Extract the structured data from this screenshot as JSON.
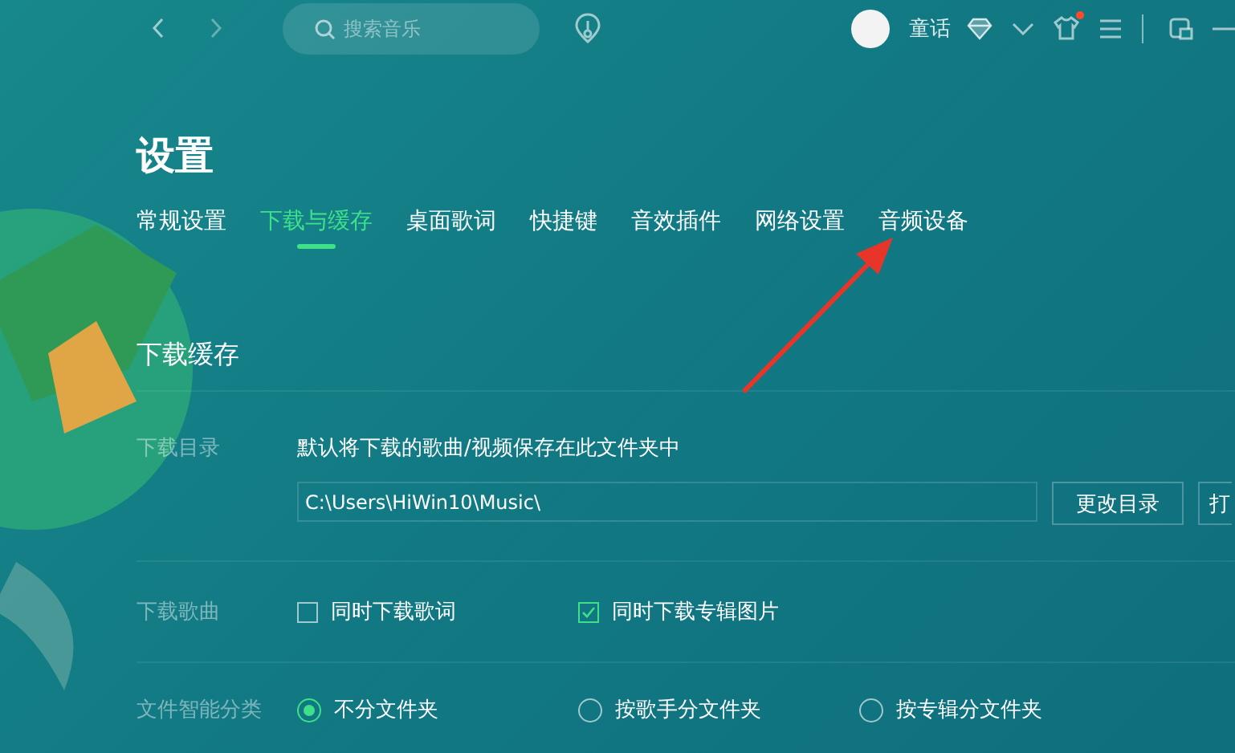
{
  "topbar": {
    "search": {
      "placeholder": "搜索音乐"
    },
    "user_name": "童话",
    "notification_dot": true
  },
  "title": "设置",
  "tabs": [
    {
      "label": "常规设置",
      "selected": false
    },
    {
      "label": "下载与缓存",
      "selected": true
    },
    {
      "label": "桌面歌词",
      "selected": false
    },
    {
      "label": "快捷键",
      "selected": false
    },
    {
      "label": "音效插件",
      "selected": false
    },
    {
      "label": "网络设置",
      "selected": false
    },
    {
      "label": "音频设备",
      "selected": false
    }
  ],
  "section_title": "下载缓存",
  "download_dir": {
    "label": "下载目录",
    "description": "默认将下载的歌曲/视频保存在此文件夹中",
    "path": "C:\\Users\\HiWin10\\Music\\",
    "buttons": [
      "更改目录",
      "打"
    ]
  },
  "download_songs": {
    "label": "下载歌曲",
    "options": [
      {
        "label": "同时下载歌词",
        "checked": false
      },
      {
        "label": "同时下载专辑图片",
        "checked": true
      }
    ]
  },
  "classify": {
    "label": "文件智能分类",
    "options": [
      {
        "label": "不分文件夹",
        "selected": true
      },
      {
        "label": "按歌手分文件夹",
        "selected": false
      },
      {
        "label": "按专辑分文件夹",
        "selected": false
      }
    ]
  },
  "annotation": {
    "kind": "arrow"
  }
}
